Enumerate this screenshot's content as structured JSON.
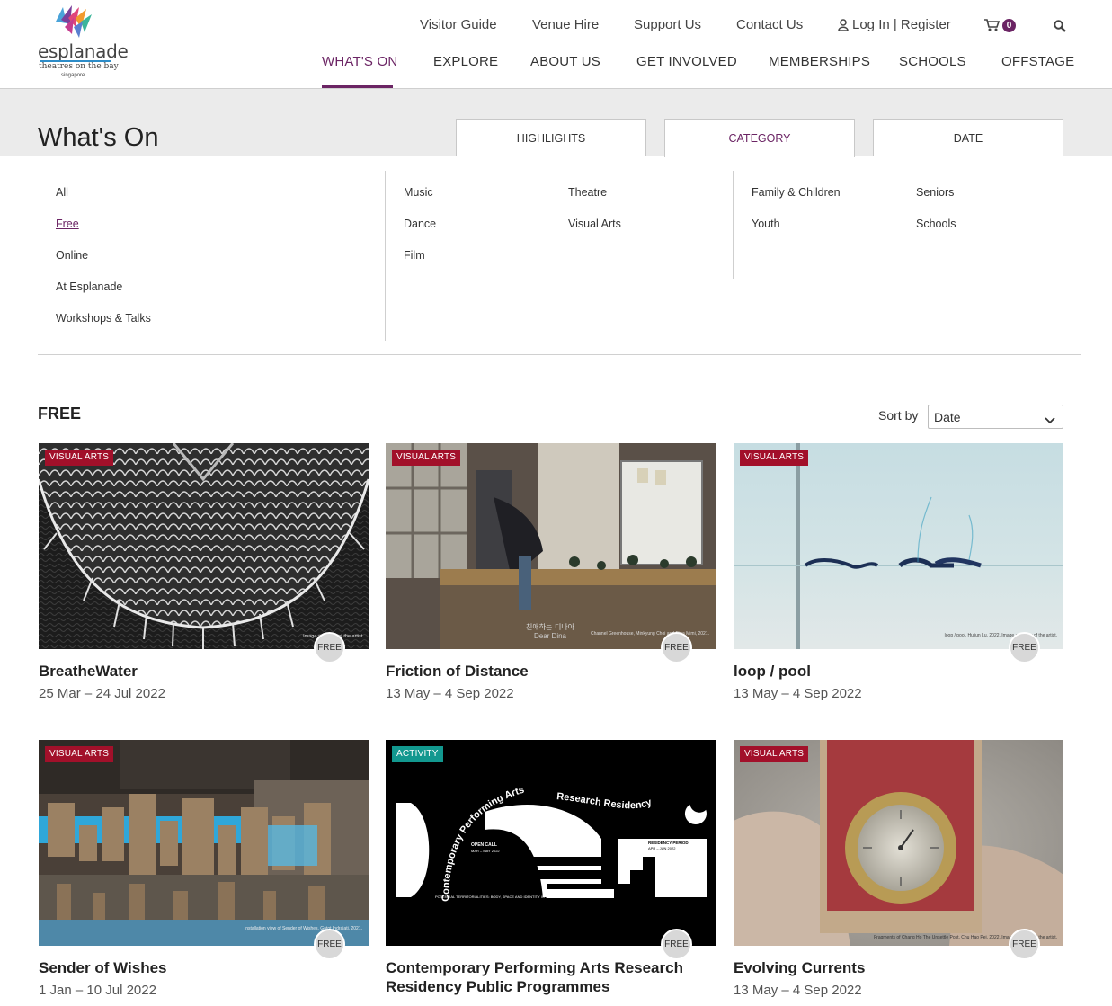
{
  "header": {
    "logo": {
      "word": "esplanade",
      "tagline": "theatres on the bay",
      "location": "singapore"
    },
    "utility_nav": [
      "Visitor Guide",
      "Venue Hire",
      "Support Us",
      "Contact Us"
    ],
    "login_label": "Log In | Register",
    "cart_count": "0",
    "main_nav": [
      {
        "label": "What's On",
        "active": true
      },
      {
        "label": "Explore"
      },
      {
        "label": "About Us"
      },
      {
        "label": "Get Involved"
      },
      {
        "label": "Memberships"
      },
      {
        "label": "Schools"
      },
      {
        "label": "Offstage"
      }
    ]
  },
  "page": {
    "title": "What's On",
    "filter_tabs": [
      {
        "label": "Highlights"
      },
      {
        "label": "Category",
        "active": true
      },
      {
        "label": "Date"
      }
    ]
  },
  "categories": {
    "general": [
      "All",
      "Free",
      "Online",
      "At Esplanade",
      "Workshops & Talks"
    ],
    "selected": "Free",
    "genres_col1": [
      "Music",
      "Dance",
      "Film"
    ],
    "genres_col2": [
      "Theatre",
      "Visual Arts"
    ],
    "audience_col1": [
      "Family & Children",
      "Youth"
    ],
    "audience_col2": [
      "Seniors",
      "Schools"
    ]
  },
  "results": {
    "heading": "Free",
    "sort_label": "Sort by",
    "sort_value": "Date",
    "free_badge": "FREE",
    "cards": [
      {
        "tag": "Visual Arts",
        "tag_color": "#a2102a",
        "title": "BreatheWater",
        "date": "25 Mar – 24 Jul 2022",
        "caption": "Image courtesy of the artist."
      },
      {
        "tag": "Visual Arts",
        "tag_color": "#a2102a",
        "title": "Friction of Distance",
        "date": "13 May – 4 Sep 2022",
        "caption": "Channel Greenhouse, Minkyung Choi and Dina Mimi, 2021.",
        "img_text": "친애하는 디나아",
        "img_text2": "Dear Dina"
      },
      {
        "tag": "Visual Arts",
        "tag_color": "#a2102a",
        "title": "loop / pool",
        "date": "13 May – 4 Sep 2022",
        "caption": "loop / pool, Huijun Lu, 2022. Image courtesy of the artist."
      },
      {
        "tag": "Visual Arts",
        "tag_color": "#a2102a",
        "title": "Sender of Wishes",
        "date": "1 Jan – 10 Jul 2022",
        "caption": "Installation view of Sender of Wishes, Gatot Indrajati, 2021."
      },
      {
        "tag": "Activity",
        "tag_color": "#12988f",
        "title": "Contemporary Performing Arts Research Residency Public Programmes",
        "date": "",
        "poster_arc1": "Contemporary Performing Arts",
        "poster_arc2": "Research Residency",
        "poster_open": "OPEN CALL",
        "poster_open_dates": "MAR – MAY 2022",
        "poster_period": "RESIDENCY PERIOD",
        "poster_period_dates": "APR – JUN 2022",
        "poster_footer": "POTENTIAL TERRITORIALITIES: BODY, SPACE AND IDENTITY IN PERFORMANCES"
      },
      {
        "tag": "Visual Arts",
        "tag_color": "#a2102a",
        "title": "Evolving Currents",
        "date": "13 May – 4 Sep 2022",
        "caption": "Fragments of Chang Ho The Unsettle Post, Chu Hao Pei, 2022. Image courtesy of the artist."
      }
    ]
  }
}
